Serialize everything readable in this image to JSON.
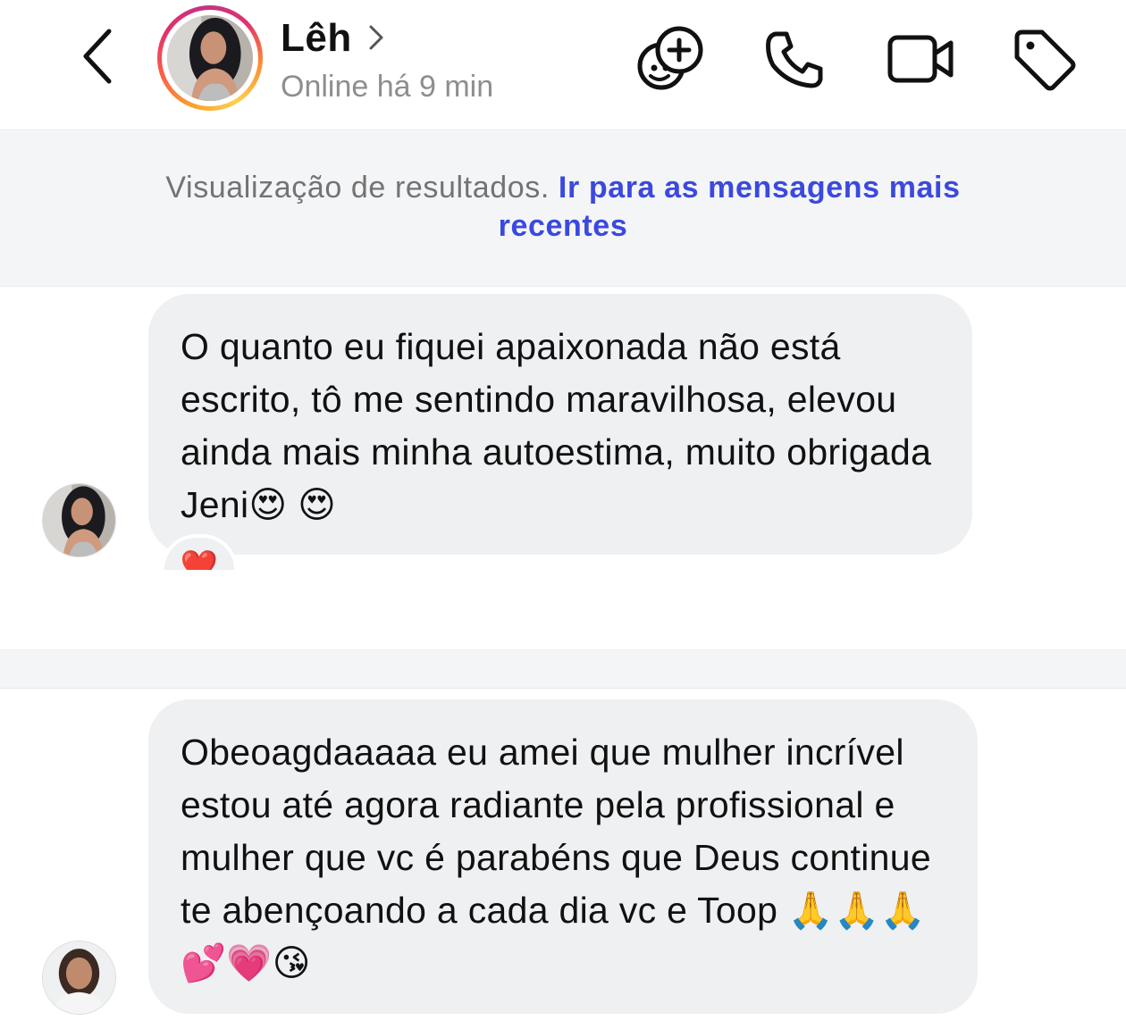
{
  "header": {
    "contact_name": "Lêh",
    "status": "Online há 9 min"
  },
  "banner": {
    "text": "Visualização de resultados.",
    "link": "Ir para as mensagens mais recentes"
  },
  "messages": [
    {
      "text": "O quanto eu fiquei apaixonada não está escrito, tô me sentindo maravilhosa, elevou ainda mais minha autoestima, muito obrigada Jeni😍 😍",
      "reaction": "❤️"
    },
    {
      "text": "Obeoagdaaaaa eu amei que mulher incrível estou até agora radiante pela profissional e mulher que vc é parabéns que Deus continue te abençoando a cada dia vc e Toop 🙏🙏🙏💕💗😘"
    }
  ],
  "icons": {
    "back": "chevron-left-icon",
    "effects": "add-effect-icon",
    "call": "phone-icon",
    "video": "video-camera-icon",
    "label": "tag-icon",
    "profile": "chevron-right-icon"
  }
}
